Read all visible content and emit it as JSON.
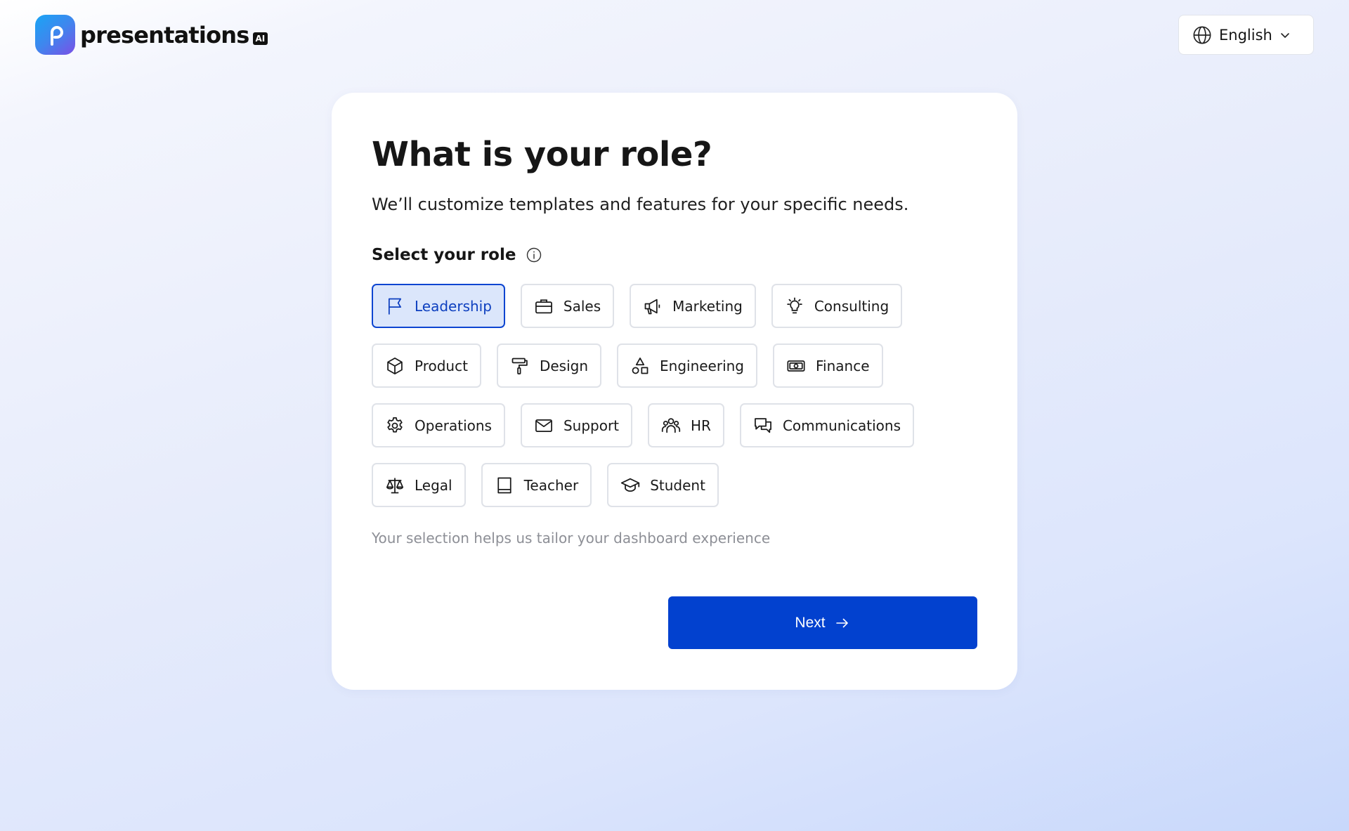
{
  "brand": {
    "name": "presentations",
    "badge": "AI"
  },
  "language": {
    "selected": "English"
  },
  "onboarding": {
    "title": "What is your role?",
    "subtitle": "We’ll customize templates and features for your specific needs.",
    "section_label": "Select your role",
    "helper_text": "Your selection helps us tailor your dashboard experience",
    "next_label": "Next",
    "selected_role": "Leadership"
  },
  "roles": [
    {
      "label": "Leadership",
      "icon": "flag-icon"
    },
    {
      "label": "Sales",
      "icon": "briefcase-icon"
    },
    {
      "label": "Marketing",
      "icon": "megaphone-icon"
    },
    {
      "label": "Consulting",
      "icon": "lightbulb-icon"
    },
    {
      "label": "Product",
      "icon": "box-icon"
    },
    {
      "label": "Design",
      "icon": "paint-roller-icon"
    },
    {
      "label": "Engineering",
      "icon": "shapes-icon"
    },
    {
      "label": "Finance",
      "icon": "banknote-icon"
    },
    {
      "label": "Operations",
      "icon": "gear-icon"
    },
    {
      "label": "Support",
      "icon": "envelope-icon"
    },
    {
      "label": "HR",
      "icon": "users-icon"
    },
    {
      "label": "Communications",
      "icon": "chat-icon"
    },
    {
      "label": "Legal",
      "icon": "scale-icon"
    },
    {
      "label": "Teacher",
      "icon": "book-icon"
    },
    {
      "label": "Student",
      "icon": "graduation-cap-icon"
    }
  ],
  "colors": {
    "accent": "#0241cf",
    "selected_bg": "#dbe6fb",
    "selected_border": "#0d45d1"
  }
}
